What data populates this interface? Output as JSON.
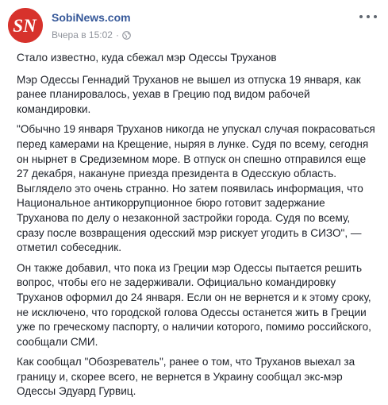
{
  "post": {
    "author": "SobiNews.com",
    "timestamp": "Вчера в 15:02",
    "separator": "·",
    "privacy_icon": "globe-icon",
    "more_icon": "ellipsis-icon",
    "avatar_text": "SN",
    "paragraphs": [
      "Стало известно, куда сбежал мэр Одессы Труханов",
      "Мэр Одессы Геннадий Труханов не вышел из отпуска 19 января, как ранее планировалось, уехав в Грецию под видом рабочей командировки.",
      "\"Обычно 19 января Труханов никогда не упускал случая покрасоваться перед камерами на Крещение, ныряя в лунке. Судя по всему, сегодня он нырнет в Средиземном море. В отпуск он спешно отправился еще 27 декабря, накануне приезда президента в Одесскую область. Выглядело это очень странно. Но затем появилась информация, что Национальное антикоррупционное бюро готовит задержание Труханова по делу о незаконной застройки города. Судя по всему, сразу после возвращения одесский мэр рискует угодить в СИЗО\", — отметил собеседник.",
      "Он также добавил, что пока из Греции мэр Одессы пытается решить вопрос, чтобы его не задерживали. Официально командировку Труханов оформил до 24 января. Если он не вернется и к этому сроку, не исключено, что городской голова Одессы останется жить в Греции уже по греческому паспорту, о наличии которого, помимо российского, сообщали СМИ.",
      "Как сообщал \"Обозреватель\", ранее о том, что Труханов выехал за границу и, скорее всего, не вернется в Украину сообщал экс-мэр Одессы Эдуард Гурвиц."
    ]
  },
  "colors": {
    "author_link": "#365899",
    "meta_text": "#90949c",
    "body_text": "#1d2129",
    "avatar_bg": "#d7322c"
  }
}
